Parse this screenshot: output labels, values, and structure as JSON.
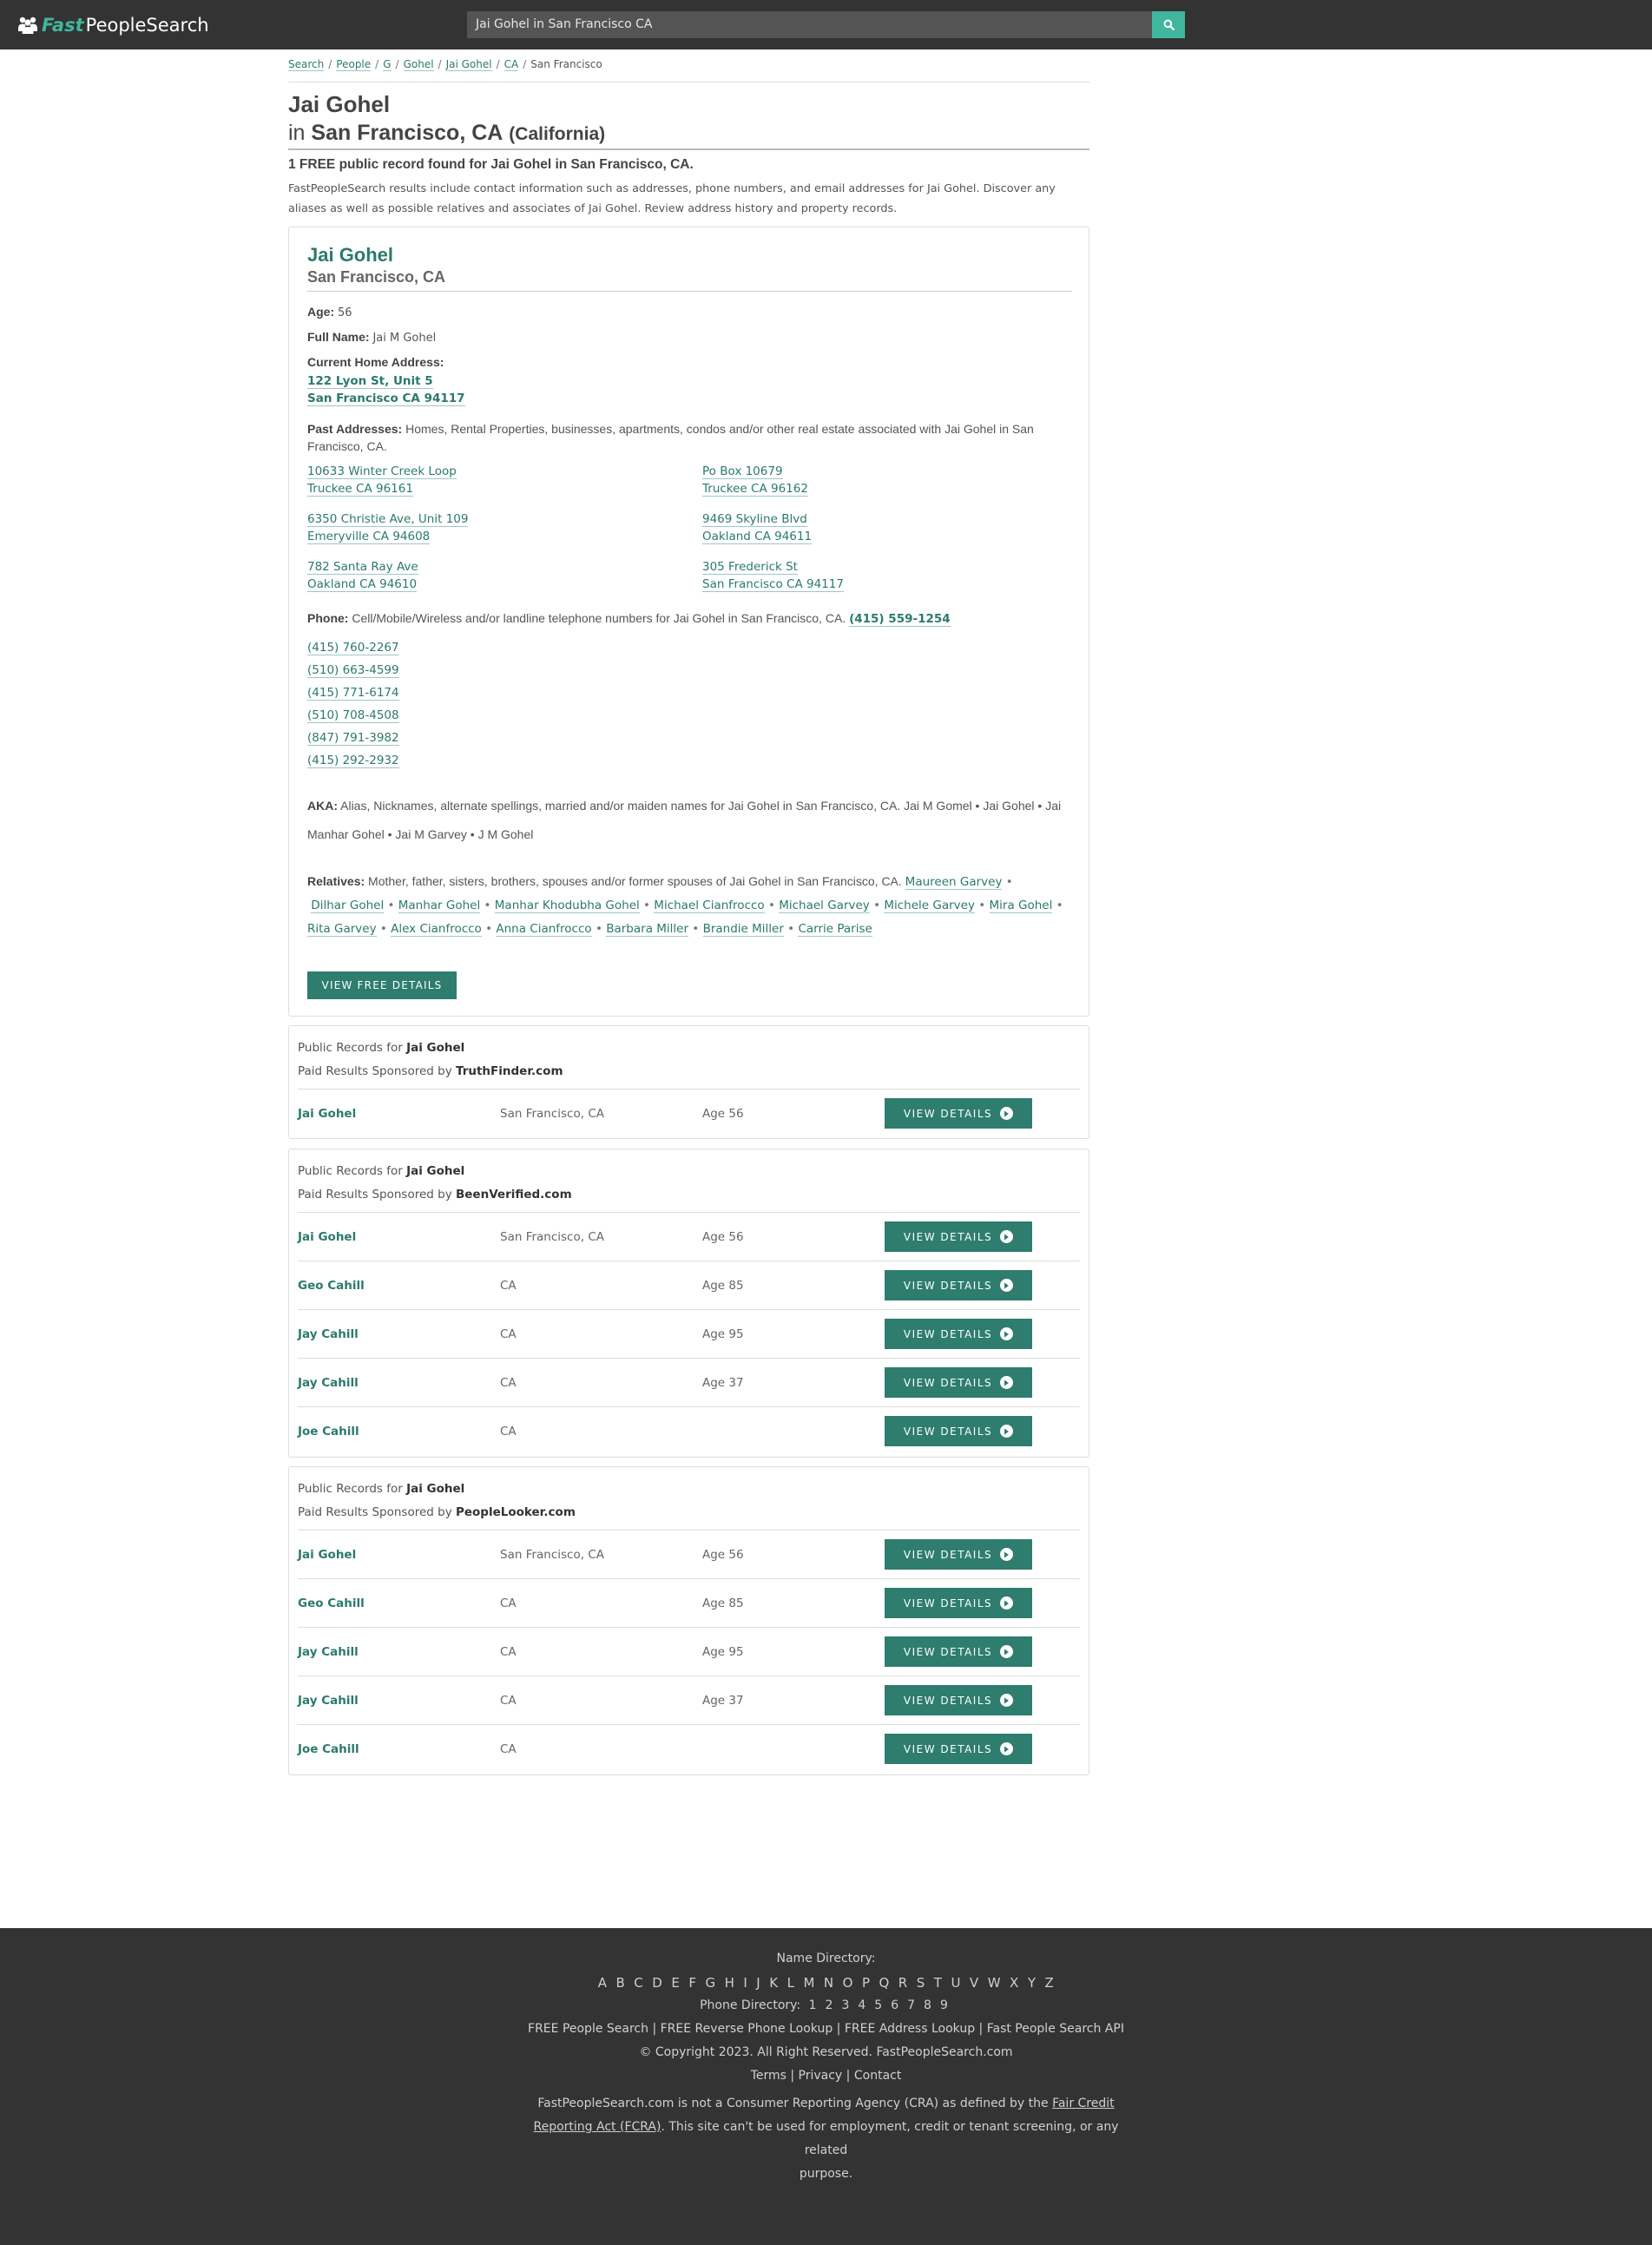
{
  "header": {
    "logo_fast": "Fast",
    "logo_rest": "PeopleSearch",
    "search_value": "Jai Gohel in San Francisco CA"
  },
  "breadcrumb": [
    "Search",
    "People",
    "G",
    "Gohel",
    "Jai Gohel",
    "CA",
    "San Francisco"
  ],
  "title": {
    "name": "Jai Gohel",
    "in": "in",
    "city": "San Francisco, CA",
    "state": "(California)"
  },
  "found": "1 FREE public record found for Jai Gohel in San Francisco, CA.",
  "intro": "FastPeopleSearch results include contact information such as addresses, phone numbers, and email addresses for Jai Gohel. Discover any aliases as well as possible relatives and associates of Jai Gohel. Review address history and property records.",
  "card": {
    "name": "Jai Gohel",
    "location": "San Francisco, CA",
    "age_label": "Age:",
    "age": "56",
    "fullname_label": "Full Name:",
    "fullname": "Jai M Gohel",
    "current_label": "Current Home Address:",
    "current_line1": "122 Lyon St, Unit 5",
    "current_line2": "San Francisco CA 94117",
    "past_label": "Past Addresses:",
    "past_desc": "Homes, Rental Properties, businesses, apartments, condos and/or other real estate associated with Jai Gohel in San Francisco, CA.",
    "past_addresses": [
      {
        "l1": "10633 Winter Creek Loop",
        "l2": "Truckee CA 96161"
      },
      {
        "l1": "Po Box 10679",
        "l2": "Truckee CA 96162"
      },
      {
        "l1": "6350 Christie Ave, Unit 109",
        "l2": "Emeryville CA 94608"
      },
      {
        "l1": "9469 Skyline Blvd",
        "l2": "Oakland CA 94611"
      },
      {
        "l1": "782 Santa Ray Ave",
        "l2": "Oakland CA 94610"
      },
      {
        "l1": "305 Frederick St",
        "l2": "San Francisco CA 94117"
      }
    ],
    "phone_label": "Phone:",
    "phone_desc": "Cell/Mobile/Wireless and/or landline telephone numbers for Jai Gohel in San Francisco, CA.",
    "phone_primary": "(415) 559-1254",
    "phones": [
      "(415) 760-2267",
      "(510) 663-4599",
      "(415) 771-6174",
      "(510) 708-4508",
      "(847) 791-3982",
      "(415) 292-2932"
    ],
    "aka_label": "AKA:",
    "aka_desc": "Alias, Nicknames, alternate spellings, married and/or maiden names for Jai Gohel in San Francisco, CA.",
    "aka": [
      "Jai M Gomel",
      "Jai Gohel",
      "Jai Manhar Gohel",
      "Jai M Garvey",
      "J M Gohel"
    ],
    "relatives_label": "Relatives:",
    "relatives_desc": "Mother, father, sisters, brothers, spouses and/or former spouses of Jai Gohel in San Francisco, CA.",
    "relatives": [
      "Maureen Garvey",
      "Dilhar Gohel",
      "Manhar Gohel",
      "Manhar Khodubha Gohel",
      "Michael Cianfrocco",
      "Michael Garvey",
      "Michele Garvey",
      "Mira Gohel",
      "Rita Garvey",
      "Alex Cianfrocco",
      "Anna Cianfrocco",
      "Barbara Miller",
      "Brandie Miller",
      "Carrie Parise"
    ],
    "button": "VIEW FREE DETAILS"
  },
  "sponsored": [
    {
      "public_records_for": "Public Records for",
      "name": "Jai Gohel",
      "paid_by": "Paid Results Sponsored by",
      "sponsor": "TruthFinder.com",
      "rows": [
        {
          "name": "Jai Gohel",
          "city": "San Francisco, CA",
          "age": "Age 56",
          "button": "VIEW DETAILS"
        }
      ]
    },
    {
      "public_records_for": "Public Records for",
      "name": "Jai Gohel",
      "paid_by": "Paid Results Sponsored by",
      "sponsor": "BeenVerified.com",
      "rows": [
        {
          "name": "Jai Gohel",
          "city": "San Francisco, CA",
          "age": "Age 56",
          "button": "VIEW DETAILS"
        },
        {
          "name": "Geo Cahill",
          "city": "CA",
          "age": "Age 85",
          "button": "VIEW DETAILS"
        },
        {
          "name": "Jay Cahill",
          "city": "CA",
          "age": "Age 95",
          "button": "VIEW DETAILS"
        },
        {
          "name": "Jay Cahill",
          "city": "CA",
          "age": "Age 37",
          "button": "VIEW DETAILS"
        },
        {
          "name": "Joe Cahill",
          "city": "CA",
          "age": "",
          "button": "VIEW DETAILS"
        }
      ]
    },
    {
      "public_records_for": "Public Records for",
      "name": "Jai Gohel",
      "paid_by": "Paid Results Sponsored by",
      "sponsor": "PeopleLooker.com",
      "rows": [
        {
          "name": "Jai Gohel",
          "city": "San Francisco, CA",
          "age": "Age 56",
          "button": "VIEW DETAILS"
        },
        {
          "name": "Geo Cahill",
          "city": "CA",
          "age": "Age 85",
          "button": "VIEW DETAILS"
        },
        {
          "name": "Jay Cahill",
          "city": "CA",
          "age": "Age 95",
          "button": "VIEW DETAILS"
        },
        {
          "name": "Jay Cahill",
          "city": "CA",
          "age": "Age 37",
          "button": "VIEW DETAILS"
        },
        {
          "name": "Joe Cahill",
          "city": "CA",
          "age": "",
          "button": "VIEW DETAILS"
        }
      ]
    }
  ],
  "footer": {
    "name_dir_label": "Name Directory:",
    "letters": [
      "A",
      "B",
      "C",
      "D",
      "E",
      "F",
      "G",
      "H",
      "I",
      "J",
      "K",
      "L",
      "M",
      "N",
      "O",
      "P",
      "Q",
      "R",
      "S",
      "T",
      "U",
      "V",
      "W",
      "X",
      "Y",
      "Z"
    ],
    "phone_dir_label": "Phone Directory:",
    "digits": [
      "1",
      "2",
      "3",
      "4",
      "5",
      "6",
      "7",
      "8",
      "9"
    ],
    "links": [
      "FREE People Search",
      "FREE Reverse Phone Lookup",
      "FREE Address Lookup",
      "Fast People Search API"
    ],
    "copyright": "© Copyright 2023. All Right Reserved. FastPeopleSearch.com",
    "legal_links": [
      "Terms",
      "Privacy",
      "Contact"
    ],
    "disclaimer_pre": "FastPeopleSearch.com is not a Consumer Reporting Agency (CRA) as defined by the",
    "disclaimer_link1": "Fair Credit",
    "disclaimer_link2": "Reporting Act (FCRA)",
    "disclaimer_post1": ". This site can't be used for employment, credit or tenant screening, or any related",
    "disclaimer_post2": "purpose."
  },
  "colors": {
    "header_bg": "#333333",
    "accent": "#3fb69d",
    "link": "#2b7a6b",
    "button": "#2e7d6e"
  },
  "icons": [
    "people-icon",
    "search-icon",
    "arrow-circle-right-icon"
  ]
}
